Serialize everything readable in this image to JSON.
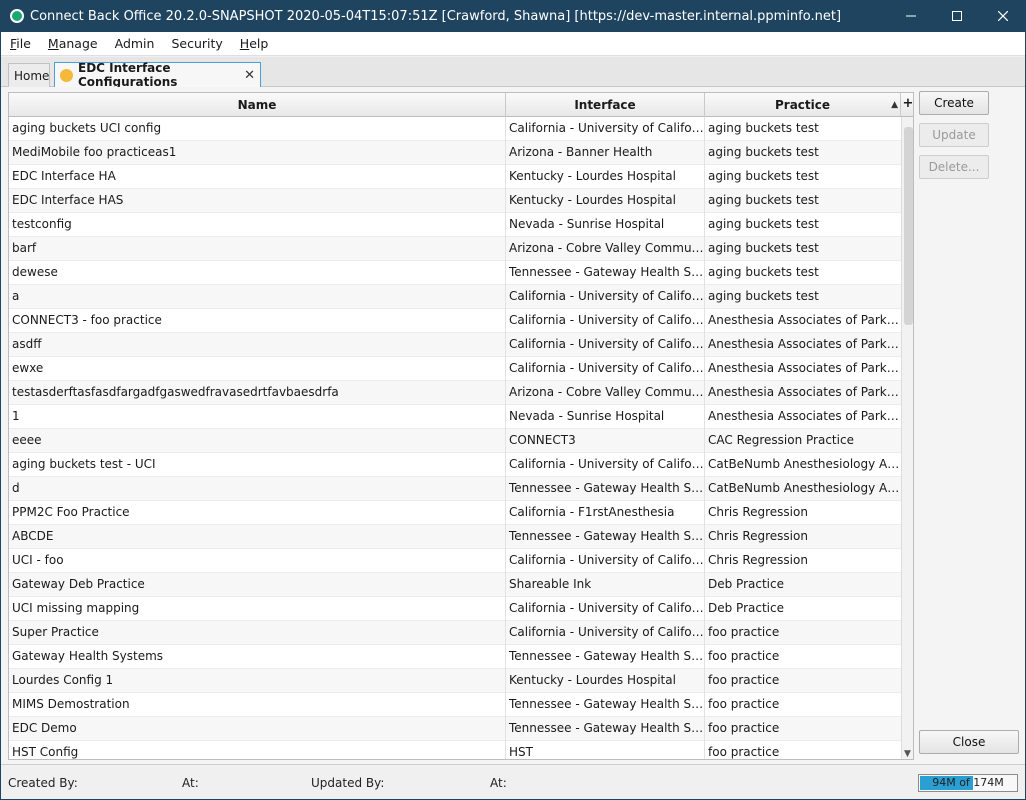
{
  "window": {
    "title": "Connect Back Office 20.2.0-SNAPSHOT 2020-05-04T15:07:51Z [Crawford, Shawna] [https://dev-master.internal.ppminfo.net]"
  },
  "menu": {
    "file": {
      "mnemonic": "F",
      "rest": "ile"
    },
    "manage": {
      "mnemonic": "M",
      "rest": "anage"
    },
    "admin": {
      "mnemonic": "A",
      "rest": "dmin"
    },
    "security": {
      "mnemonic": "S",
      "rest": "ecurity"
    },
    "help": {
      "mnemonic": "H",
      "rest": "elp"
    }
  },
  "tabs": {
    "home": "Home",
    "edc": "EDC Interface Configurations",
    "close_glyph": "✕"
  },
  "table": {
    "headers": {
      "name": "Name",
      "interface": "Interface",
      "practice": "Practice",
      "sort_glyph": "▲",
      "add_glyph": "+"
    },
    "rows": [
      {
        "name": "aging buckets UCI config",
        "interface": "California - University of California...",
        "practice": "aging buckets test"
      },
      {
        "name": "MediMobile foo practiceas1",
        "interface": "Arizona - Banner Health",
        "practice": "aging buckets test"
      },
      {
        "name": "EDC Interface HA",
        "interface": "Kentucky - Lourdes Hospital",
        "practice": "aging buckets test"
      },
      {
        "name": "EDC Interface HAS",
        "interface": "Kentucky - Lourdes Hospital",
        "practice": "aging buckets test"
      },
      {
        "name": "testconfig",
        "interface": "Nevada - Sunrise Hospital",
        "practice": "aging buckets test"
      },
      {
        "name": "barf",
        "interface": "Arizona - Cobre Valley Community...",
        "practice": "aging buckets test"
      },
      {
        "name": "dewese",
        "interface": "Tennessee - Gateway Health System",
        "practice": "aging buckets test"
      },
      {
        "name": "a",
        "interface": "California - University of California...",
        "practice": "aging buckets test"
      },
      {
        "name": "CONNECT3 - foo practice",
        "interface": "California - University of California...",
        "practice": "Anesthesia Associates of Parkville"
      },
      {
        "name": "asdff",
        "interface": "California - University of California...",
        "practice": "Anesthesia Associates of Parkville"
      },
      {
        "name": "ewxe",
        "interface": "California - University of California...",
        "practice": "Anesthesia Associates of Parkville"
      },
      {
        "name": "testasderftasfasdfargadfgaswedfravasedrtfavbaesdrfa",
        "interface": "Arizona - Cobre Valley Community...",
        "practice": "Anesthesia Associates of Parkville"
      },
      {
        "name": "1",
        "interface": "Nevada - Sunrise Hospital",
        "practice": "Anesthesia Associates of Parkville"
      },
      {
        "name": "eeee",
        "interface": "CONNECT3",
        "practice": "CAC Regression Practice"
      },
      {
        "name": "aging buckets test - UCI",
        "interface": "California - University of California...",
        "practice": "CatBeNumb Anesthesiology Assoc..."
      },
      {
        "name": "d",
        "interface": "Tennessee - Gateway Health System",
        "practice": "CatBeNumb Anesthesiology Assoc..."
      },
      {
        "name": "PPM2C Foo Practice",
        "interface": "California - F1rstAnesthesia",
        "practice": "Chris Regression"
      },
      {
        "name": "ABCDE",
        "interface": "Tennessee - Gateway Health System",
        "practice": "Chris Regression"
      },
      {
        "name": "UCI - foo",
        "interface": "California - University of California...",
        "practice": "Chris Regression"
      },
      {
        "name": "Gateway Deb Practice",
        "interface": "Shareable Ink",
        "practice": "Deb Practice"
      },
      {
        "name": "UCI missing mapping",
        "interface": "California - University of California...",
        "practice": "Deb Practice"
      },
      {
        "name": "Super Practice",
        "interface": "California - University of California...",
        "practice": "foo practice"
      },
      {
        "name": "Gateway Health Systems",
        "interface": "Tennessee - Gateway Health System",
        "practice": "foo practice"
      },
      {
        "name": "Lourdes Config 1",
        "interface": "Kentucky - Lourdes Hospital",
        "practice": "foo practice"
      },
      {
        "name": "MIMS Demostration",
        "interface": "Tennessee - Gateway Health System",
        "practice": "foo practice"
      },
      {
        "name": "EDC Demo",
        "interface": "Tennessee - Gateway Health System",
        "practice": "foo practice"
      },
      {
        "name": "HST Config",
        "interface": "HST",
        "practice": "foo practice"
      }
    ]
  },
  "buttons": {
    "create": "Create",
    "update": "Update",
    "delete": "Delete...",
    "close": "Close"
  },
  "status": {
    "created_by": "Created By:",
    "at1": "At:",
    "updated_by": "Updated By:",
    "at2": "At:",
    "memory": "94M of 174M",
    "memory_fraction": 0.54
  },
  "colors": {
    "titlebar": "#1f4460",
    "tab_dot": "#f4b83a",
    "memory_fill": "#2b9fd1"
  }
}
